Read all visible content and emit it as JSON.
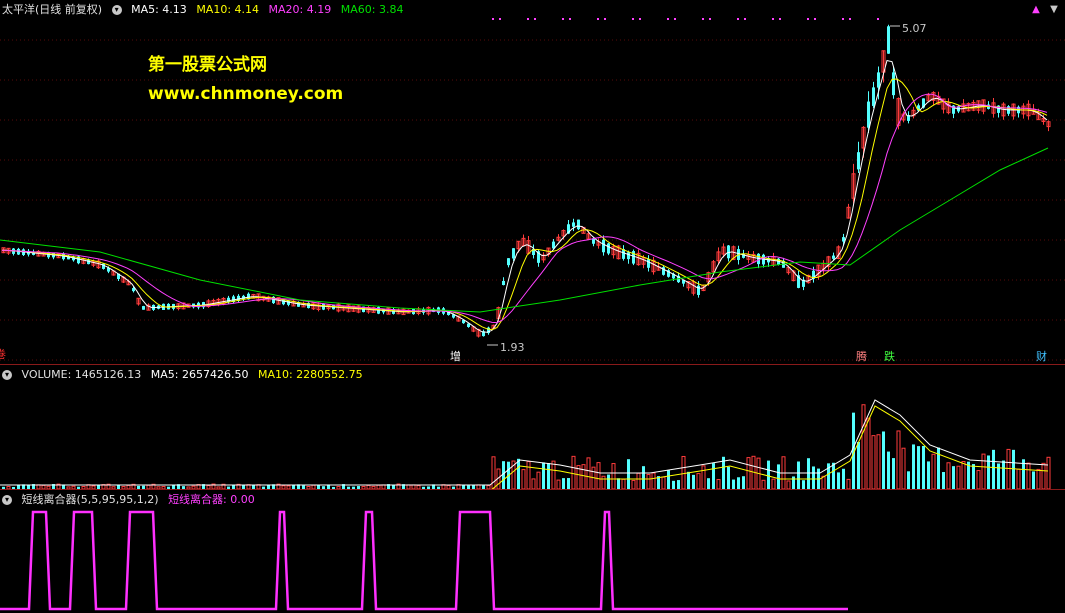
{
  "main": {
    "title": "太平洋(日线 前复权)",
    "ma5_label": "MA5: 4.13",
    "ma10_label": "MA10: 4.14",
    "ma20_label": "MA20: 4.19",
    "ma60_label": "MA60: 3.84",
    "watermark_line1": "第一股票公式网",
    "watermark_line2": "www.chnmoney.com",
    "high_label": "5.07",
    "low_label": "1.93",
    "marker_left": "卷",
    "marker_zeng": "增",
    "marker_teng": "腾",
    "marker_die": "跌",
    "marker_cai": "财",
    "colors": {
      "up": "#ff3c3c",
      "down": "#54ffff",
      "ma5": "#ffffff",
      "ma10": "#ffff00",
      "ma20": "#ff40ff",
      "ma60": "#00e000"
    }
  },
  "volume": {
    "label": "VOLUME: 1465126.13",
    "ma5_label": "MA5: 2657426.50",
    "ma10_label": "MA10: 2280552.75"
  },
  "indicator": {
    "label": "短线离合器(5,5,95,95,1,2)",
    "value_label": "短线离合器: 0.00",
    "color": "#ff30ff"
  },
  "icons": {
    "up": "up-arrow-icon",
    "down": "down-arrow-icon",
    "toggle": "chevron-down-icon"
  }
}
